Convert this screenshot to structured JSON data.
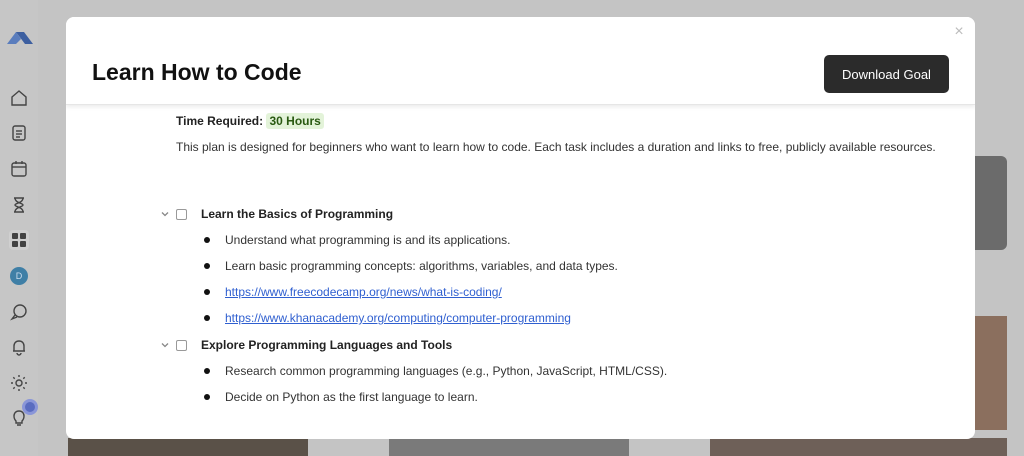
{
  "modal": {
    "title": "Learn How to Code",
    "download_label": "Download Goal",
    "close_glyph": "×"
  },
  "plan": {
    "time_label": "Time Required:",
    "time_value": "30 Hours",
    "intro": "This plan is designed for beginners who want to learn how to code. Each task includes a duration and links to free, publicly available resources.",
    "sections": [
      {
        "label": "Learn the Basics of Programming",
        "items": [
          "Understand what programming is and its applications.",
          "Learn basic programming concepts: algorithms, variables, and data types.",
          "https://www.freecodecamp.org/news/what-is-coding/",
          "https://www.khanacademy.org/computing/computer-programming"
        ]
      },
      {
        "label": "Explore Programming Languages and Tools",
        "items": [
          "Research common programming languages (e.g., Python, JavaScript, HTML/CSS).",
          "Decide on Python as the first language to learn."
        ]
      }
    ]
  },
  "sidebar": {
    "avatar_initial": "D",
    "icons": [
      "home-icon",
      "list-icon",
      "calendar-icon",
      "hourglass-icon",
      "grid-icon",
      "chat-icon",
      "bell-icon",
      "gear-icon",
      "lightbulb-icon"
    ]
  }
}
